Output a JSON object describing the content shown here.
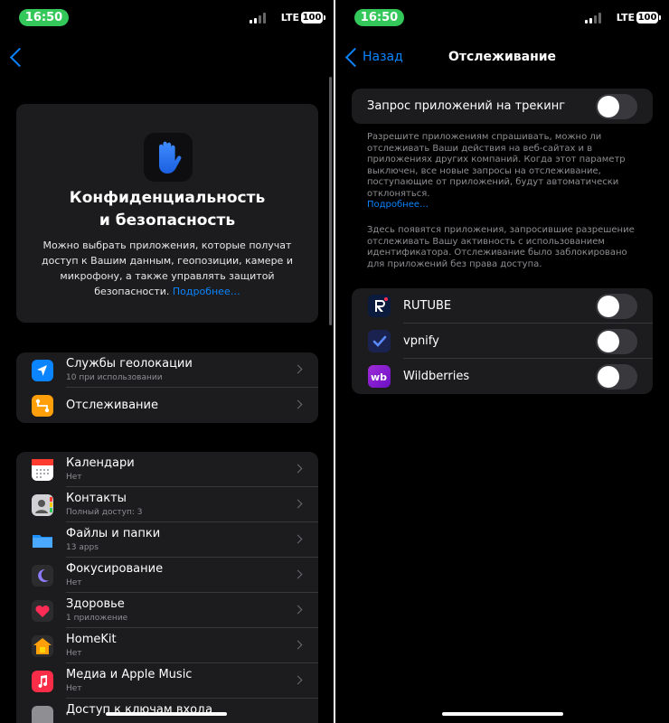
{
  "status_bar": {
    "time": "16:50",
    "network": "LTE",
    "battery": "100"
  },
  "left": {
    "hero": {
      "title_line1": "Конфиденциальность",
      "title_line2": "и безопасность",
      "description": "Можно выбрать приложения, которые получат доступ к Вашим данным, геопозиции, камере и микрофону, а также управлять защитой безопасности.",
      "more_link": "Подробнее…",
      "icon": "hand-raised-icon"
    },
    "group1": [
      {
        "title": "Службы геолокации",
        "subtitle": "10 при использовании",
        "icon": "location-arrow-icon"
      },
      {
        "title": "Отслеживание",
        "subtitle": "",
        "icon": "tracking-icon"
      }
    ],
    "group2": [
      {
        "title": "Календари",
        "subtitle": "Нет",
        "icon": "calendar-icon"
      },
      {
        "title": "Контакты",
        "subtitle": "Полный доступ: 3",
        "icon": "contacts-icon"
      },
      {
        "title": "Файлы и папки",
        "subtitle": "13 apps",
        "icon": "folder-icon"
      },
      {
        "title": "Фокусирование",
        "subtitle": "Нет",
        "icon": "moon-icon"
      },
      {
        "title": "Здоровье",
        "subtitle": "1 приложение",
        "icon": "heart-icon"
      },
      {
        "title": "HomeKit",
        "subtitle": "Нет",
        "icon": "home-icon"
      },
      {
        "title": "Медиа и Apple Music",
        "subtitle": "Нет",
        "icon": "music-note-icon"
      },
      {
        "title": "Доступ к ключам входа",
        "subtitle": "",
        "icon": "key-icon"
      }
    ]
  },
  "right": {
    "nav": {
      "back_label": "Назад",
      "title": "Отслеживание"
    },
    "toggle_row": {
      "label": "Запрос приложений на трекинг",
      "enabled": false
    },
    "footer1": "Разрешите приложениям спрашивать, можно ли отслеживать Ваши действия на веб-сайтах и в приложениях других компаний. Когда этот параметр выключен, все новые запросы на отслеживание, поступающие от приложений, будут автоматически отклоняться.",
    "footer1_link": "Подробнее…",
    "footer2": "Здесь появятся приложения, запросившие разрешение отслеживать Вашу активность с использованием идентификатора. Отслеживание было заблокировано для приложений без права доступа.",
    "apps": [
      {
        "name": "RUTUBE",
        "enabled": false,
        "icon": "rutube-icon",
        "color": "#0b1b3d"
      },
      {
        "name": "vpnify",
        "enabled": false,
        "icon": "vpnify-icon",
        "color": "#1a2350"
      },
      {
        "name": "Wildberries",
        "enabled": false,
        "icon": "wildberries-icon",
        "color": "#8b1fd0"
      }
    ]
  }
}
